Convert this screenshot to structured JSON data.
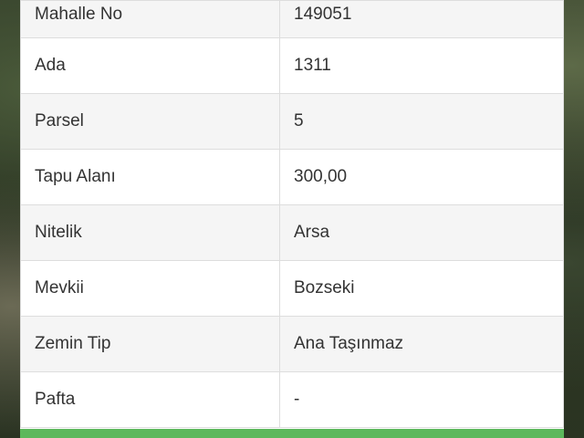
{
  "rows": [
    {
      "label": "Mahalle No",
      "value": "149051"
    },
    {
      "label": "Ada",
      "value": "1311"
    },
    {
      "label": "Parsel",
      "value": "5"
    },
    {
      "label": "Tapu Alanı",
      "value": "300,00"
    },
    {
      "label": "Nitelik",
      "value": "Arsa"
    },
    {
      "label": "Mevkii",
      "value": "Bozseki"
    },
    {
      "label": "Zemin Tip",
      "value": "Ana Taşınmaz"
    },
    {
      "label": "Pafta",
      "value": "-"
    }
  ],
  "colors": {
    "footer_bar": "#5cb85c",
    "row_striped": "#f5f5f5",
    "row_plain": "#ffffff",
    "text": "#333333",
    "border": "#dddddd"
  }
}
